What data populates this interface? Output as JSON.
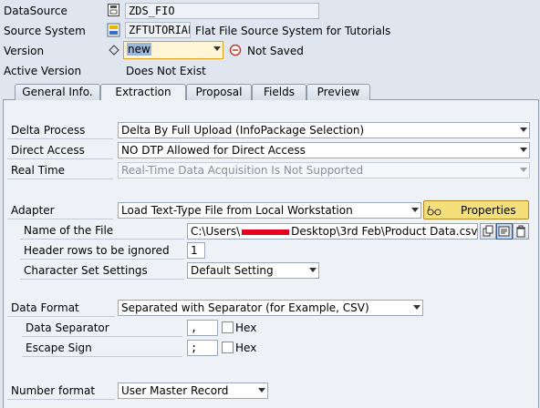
{
  "header": {
    "datasource_label": "DataSource",
    "datasource_value": "ZDS_FIO",
    "source_system_label": "Source System",
    "source_system_value": "ZFTUTORIAL",
    "source_system_desc": "Flat File Source System for Tutorials",
    "version_label": "Version",
    "version_value": "new",
    "version_status": "Not Saved",
    "active_version_label": "Active Version",
    "active_version_value": "Does Not Exist"
  },
  "tabs": [
    {
      "label": "General Info."
    },
    {
      "label": "Extraction"
    },
    {
      "label": "Proposal"
    },
    {
      "label": "Fields"
    },
    {
      "label": "Preview"
    }
  ],
  "extraction": {
    "delta_process_label": "Delta Process",
    "delta_process_value": "Delta By Full Upload (InfoPackage Selection)",
    "direct_access_label": "Direct Access",
    "direct_access_value": "NO DTP Allowed for Direct Access",
    "real_time_label": "Real Time",
    "real_time_value": "Real-Time Data Acquisition Is Not Supported",
    "adapter_label": "Adapter",
    "adapter_value": "Load Text-Type File from Local Workstation",
    "properties_button": "Properties",
    "file_name_label": "Name of the File",
    "file_name_prefix": "C:\\Users\\",
    "file_name_suffix": "Desktop\\3rd Feb\\Product Data.csv",
    "header_rows_label": "Header rows to be ignored",
    "header_rows_value": "1",
    "charset_label": "Character Set Settings",
    "charset_value": "Default Setting",
    "data_format_label": "Data Format",
    "data_format_value": "Separated with Separator (for Example, CSV)",
    "data_separator_label": "Data Separator",
    "data_separator_value": ",",
    "data_separator_hex": "Hex",
    "escape_sign_label": "Escape Sign",
    "escape_sign_value": ";",
    "escape_sign_hex": "Hex",
    "number_format_label": "Number format",
    "number_format_value": "User Master Record"
  },
  "colors": {
    "redaction": "#e8001c",
    "required_field_border": "#e0a020",
    "properties_button_bg": "#f5df7a"
  }
}
